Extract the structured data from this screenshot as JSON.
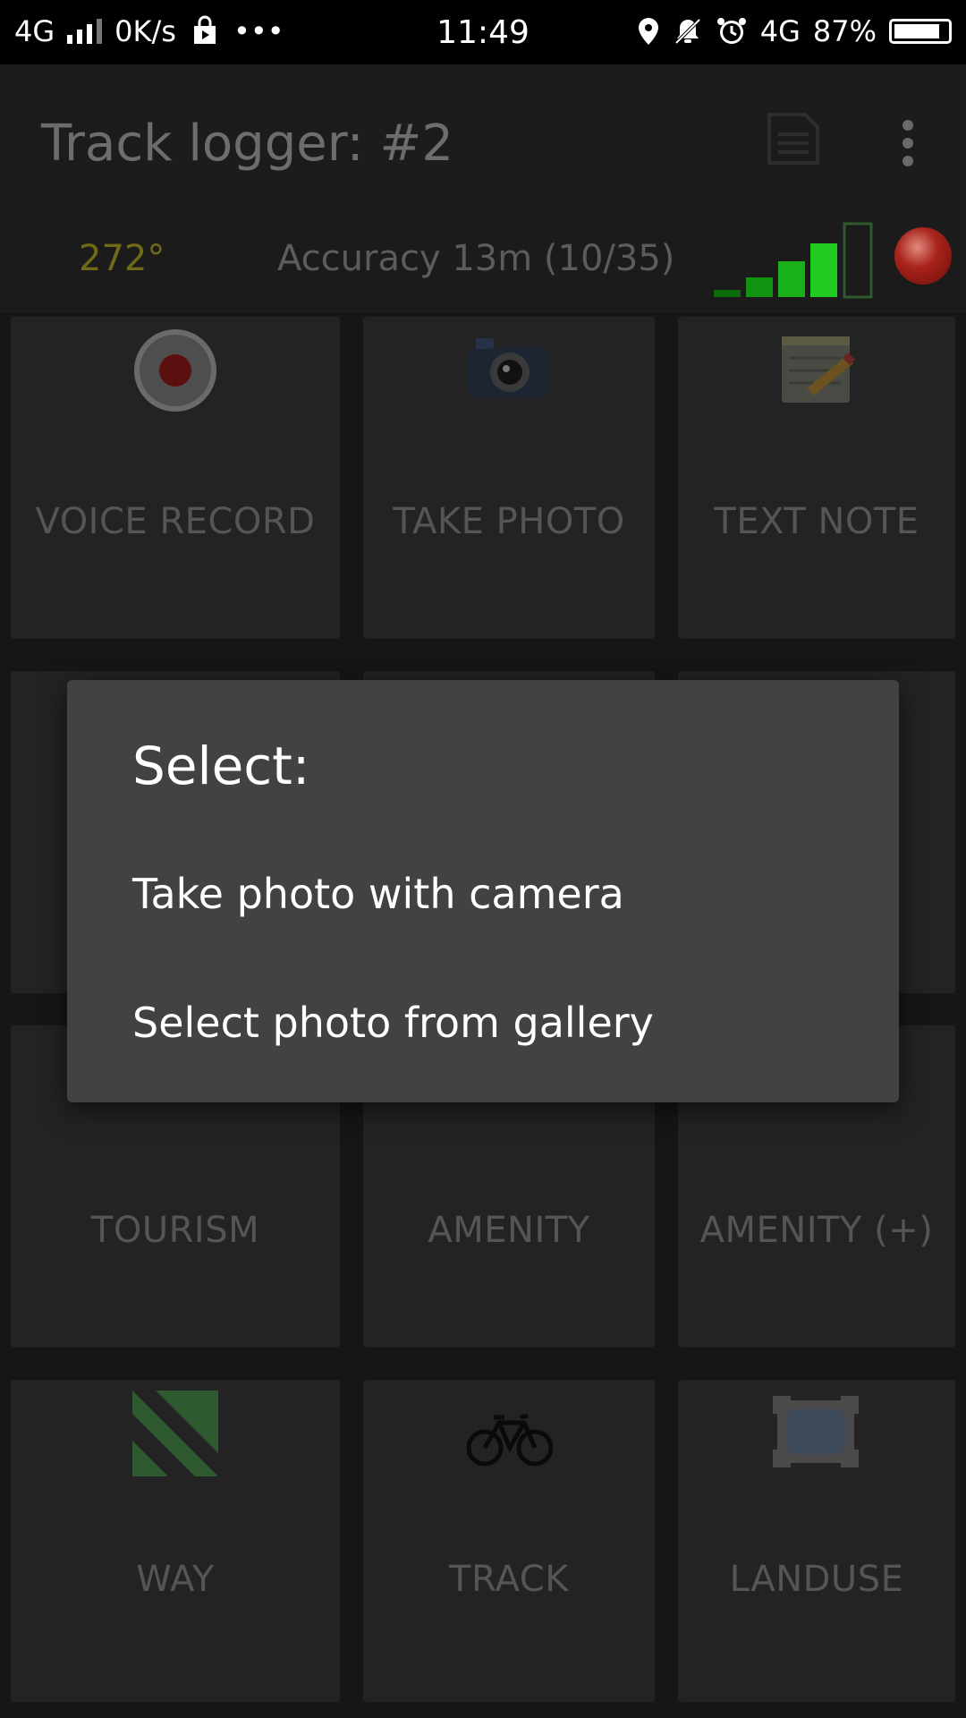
{
  "status_bar": {
    "network": "4G",
    "speed": "0K/s",
    "more": "•••",
    "time": "11:49",
    "network_right": "4G",
    "battery": "87%",
    "battery_level": 0.87
  },
  "app_bar": {
    "title": "Track logger: #2"
  },
  "gps": {
    "heading": "272°",
    "accuracy": "Accuracy 13m (10/35)",
    "signal_colors": [
      "#0c6d0c",
      "#129412",
      "#19b019",
      "#1fcc1f"
    ]
  },
  "tiles": {
    "voice_record": "VOICE RECORD",
    "take_photo": "TAKE PHOTO",
    "text_note": "TEXT NOTE",
    "tourism": "TOURISM",
    "amenity": "AMENITY",
    "amenity_plus": "AMENITY (+)",
    "way": "WAY",
    "track": "TRACK",
    "landuse": "LANDUSE"
  },
  "dialog": {
    "title": "Select:",
    "items": [
      "Take photo with camera",
      "Select photo from gallery"
    ]
  }
}
